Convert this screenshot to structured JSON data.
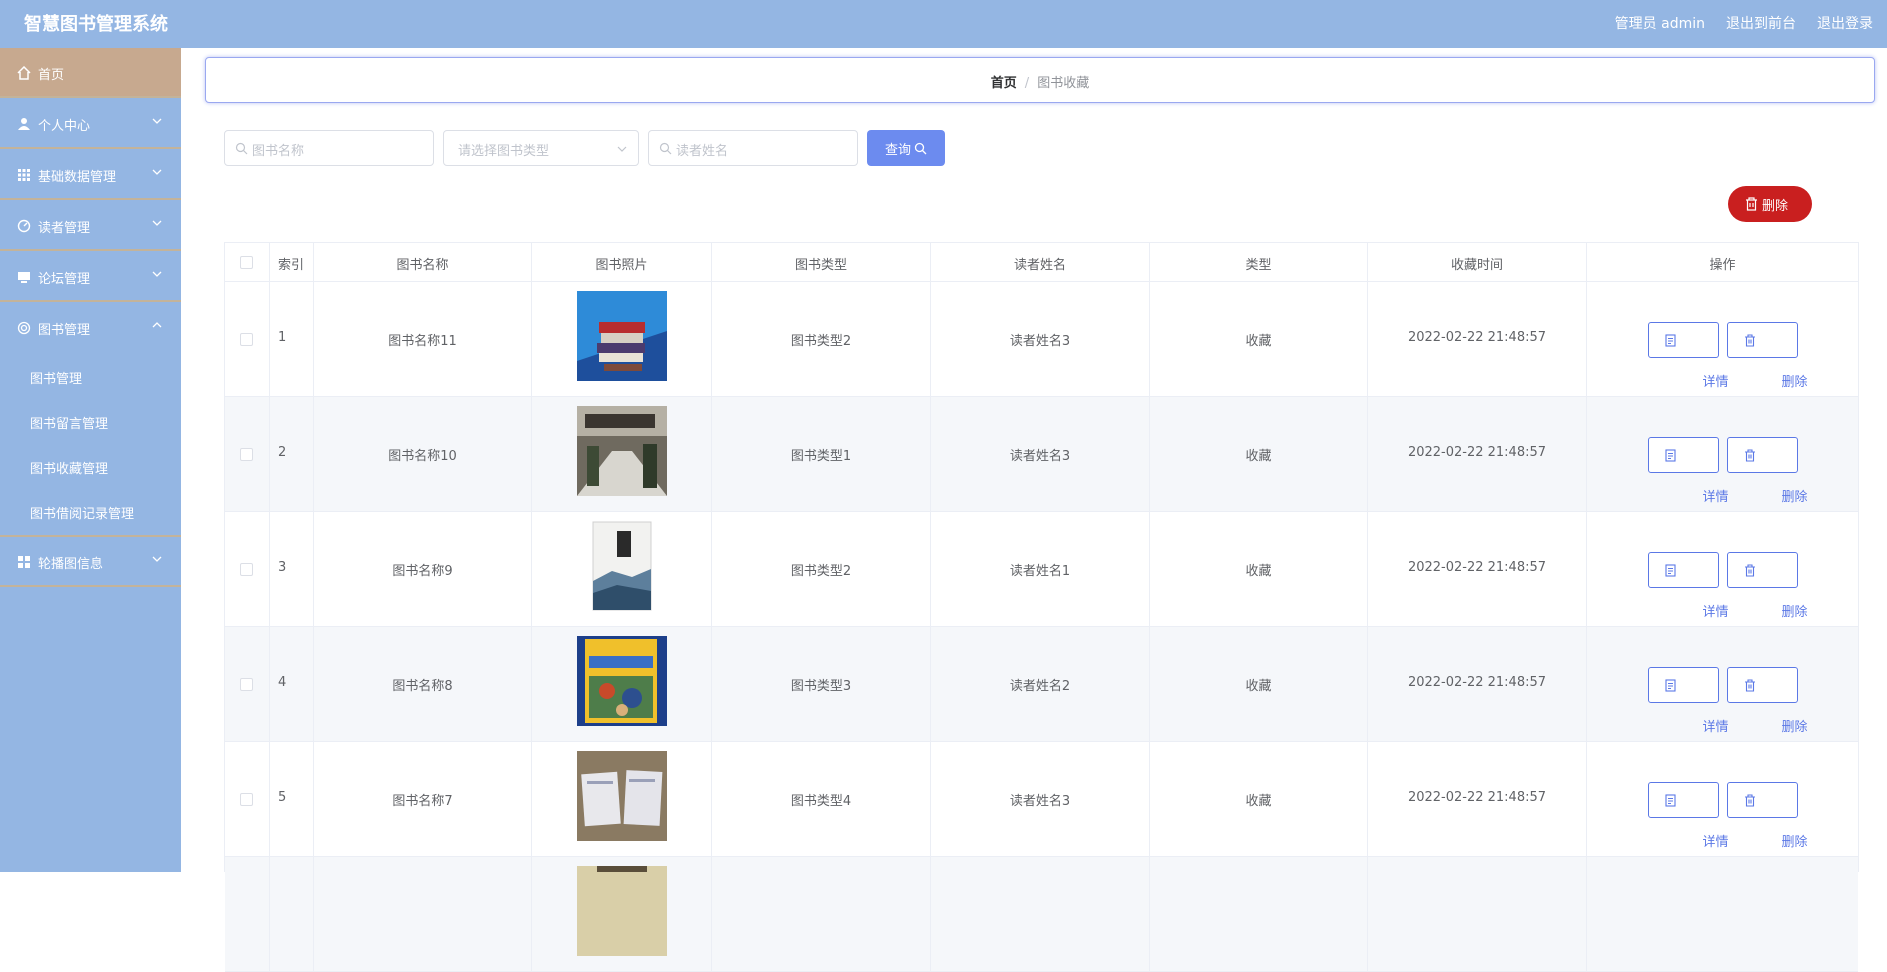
{
  "header": {
    "title": "智慧图书管理系统",
    "user_label": "管理员 admin",
    "frontend_link": "退出到前台",
    "logout_link": "退出登录"
  },
  "sidebar": {
    "items": [
      {
        "label": "首页",
        "icon": "home-icon"
      },
      {
        "label": "个人中心",
        "icon": "user-icon"
      },
      {
        "label": "基础数据管理",
        "icon": "grid-icon"
      },
      {
        "label": "读者管理",
        "icon": "dashboard-icon"
      },
      {
        "label": "论坛管理",
        "icon": "monitor-icon"
      },
      {
        "label": "图书管理",
        "icon": "target-icon"
      },
      {
        "label": "轮播图信息",
        "icon": "menu-icon"
      }
    ],
    "book_sub_items": [
      "图书管理",
      "图书留言管理",
      "图书收藏管理",
      "图书借阅记录管理"
    ]
  },
  "breadcrumb": {
    "home": "首页",
    "separator": "/",
    "current": "图书收藏"
  },
  "search": {
    "book_name_placeholder": "图书名称",
    "book_type_placeholder": "请选择图书类型",
    "reader_name_placeholder": "读者姓名",
    "query_label": "查询",
    "delete_label": "删除"
  },
  "table": {
    "columns": [
      "索引",
      "图书名称",
      "图书照片",
      "图书类型",
      "读者姓名",
      "类型",
      "收藏时间",
      "操作"
    ],
    "detail_label": "详情",
    "delete_label": "删除",
    "rows": [
      {
        "index": "1",
        "book_name": "图书名称11",
        "book_type": "图书类型2",
        "reader": "读者姓名3",
        "kind": "收藏",
        "time": "2022-02-22 21:48:57"
      },
      {
        "index": "2",
        "book_name": "图书名称10",
        "book_type": "图书类型1",
        "reader": "读者姓名3",
        "kind": "收藏",
        "time": "2022-02-22 21:48:57"
      },
      {
        "index": "3",
        "book_name": "图书名称9",
        "book_type": "图书类型2",
        "reader": "读者姓名1",
        "kind": "收藏",
        "time": "2022-02-22 21:48:57"
      },
      {
        "index": "4",
        "book_name": "图书名称8",
        "book_type": "图书类型3",
        "reader": "读者姓名2",
        "kind": "收藏",
        "time": "2022-02-22 21:48:57"
      },
      {
        "index": "5",
        "book_name": "图书名称7",
        "book_type": "图书类型4",
        "reader": "读者姓名3",
        "kind": "收藏",
        "time": "2022-02-22 21:48:57"
      }
    ]
  },
  "colors": {
    "header_bg": "#94b6e3",
    "active_menu": "#c7a98f",
    "primary": "#6c8bef",
    "danger": "#c91f1f"
  }
}
